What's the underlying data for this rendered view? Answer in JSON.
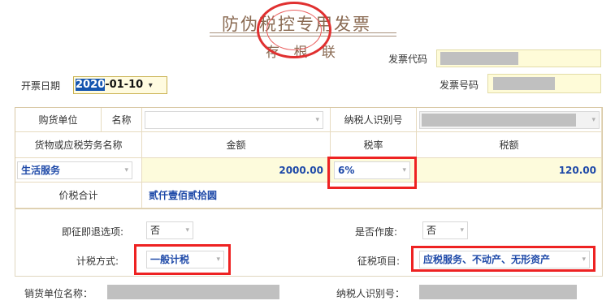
{
  "header": {
    "title": "防伪税控专用发票",
    "subtitle": "存 根 联",
    "invoice_code_label": "发票代码",
    "invoice_number_label": "发票号码"
  },
  "issue": {
    "date_label": "开票日期",
    "date_year": "2020",
    "date_rest": "-01-10",
    "date_caret": "▾"
  },
  "buyer": {
    "unit_label": "购货单位",
    "name_label": "名称",
    "tax_id_label": "纳税人识别号"
  },
  "items_header": {
    "goods_label": "货物或应税劳务名称",
    "amount_label": "金额",
    "rate_label": "税率",
    "tax_label": "税额"
  },
  "item": {
    "name": "生活服务",
    "amount": "2000.00",
    "rate": "6%",
    "tax": "120.00"
  },
  "total": {
    "label": "价税合计",
    "value": "贰仟壹佰贰拾圆"
  },
  "options": {
    "immediate_refund_label": "即征即退选项:",
    "immediate_refund_value": "否",
    "voided_label": "是否作废:",
    "voided_value": "否",
    "tax_method_label": "计税方式:",
    "tax_method_value": "一般计税",
    "levy_item_label": "征税项目:",
    "levy_item_value": "应税服务、不动产、无形资产"
  },
  "seller": {
    "name_label": "销货单位名称：",
    "tax_id_label": "纳税人识别号："
  },
  "icons": {
    "dropdown": "▾"
  },
  "colors": {
    "highlight_border": "#ee2222",
    "value_blue": "#1e49a8",
    "field_yellow": "#fdfbdc"
  }
}
